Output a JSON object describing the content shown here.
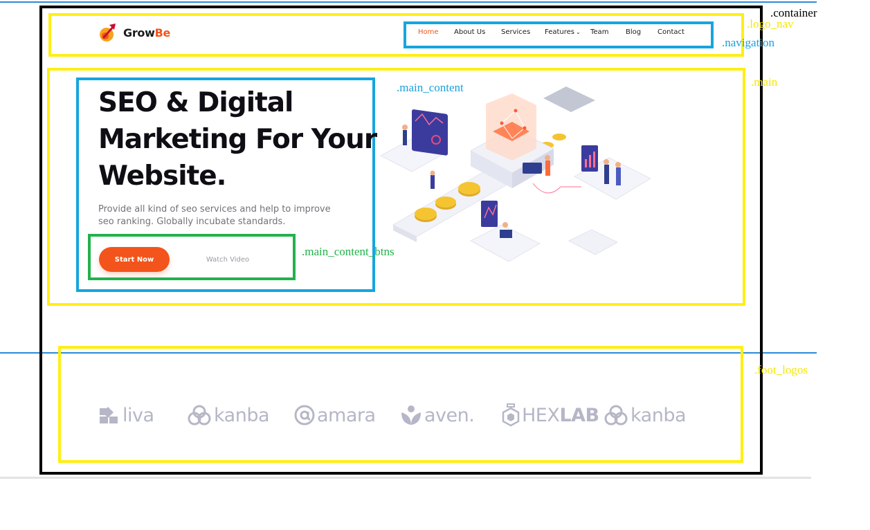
{
  "brand": {
    "name_part1": "Grow",
    "name_part2": "Be"
  },
  "nav": {
    "items": [
      {
        "label": "Home",
        "active": true
      },
      {
        "label": "About Us"
      },
      {
        "label": "Services"
      },
      {
        "label": "Features",
        "has_dropdown": true
      },
      {
        "label": "Team"
      },
      {
        "label": "Blog"
      },
      {
        "label": "Contact"
      }
    ]
  },
  "hero": {
    "title_lines": [
      "SEO & Digital",
      "Marketing For Your",
      "Website."
    ],
    "desc_lines": [
      "Provide all kind of seo services and help to improve",
      "seo ranking. Globally incubate standards."
    ],
    "start_label": "Start Now",
    "watch_label": "Watch Video"
  },
  "foot_logos": [
    {
      "icon": "liva-icon",
      "text": "liva"
    },
    {
      "icon": "kanba-icon",
      "text": "kanba"
    },
    {
      "icon": "amara-icon",
      "text": "amara"
    },
    {
      "icon": "aven-icon",
      "text": "aven."
    },
    {
      "icon": "hexlab-icon",
      "text_a": "HEX",
      "text_b": "LAB"
    },
    {
      "icon": "kanba-icon",
      "text": "kanba"
    }
  ],
  "annotations": {
    "container": ".container",
    "logo_nav": ".logo_nav",
    "navigation": ".navigation",
    "main": ".main",
    "main_content": ".main_content",
    "main_content_btns": ".main_content_btns",
    "foot_logos": ".foot_logos"
  },
  "colors": {
    "accent": "#f2541b",
    "annotation_yellow": "#ffef12",
    "annotation_blue": "#16a5e0",
    "annotation_green": "#22b24c",
    "logo_gray": "#b5b7c7"
  }
}
